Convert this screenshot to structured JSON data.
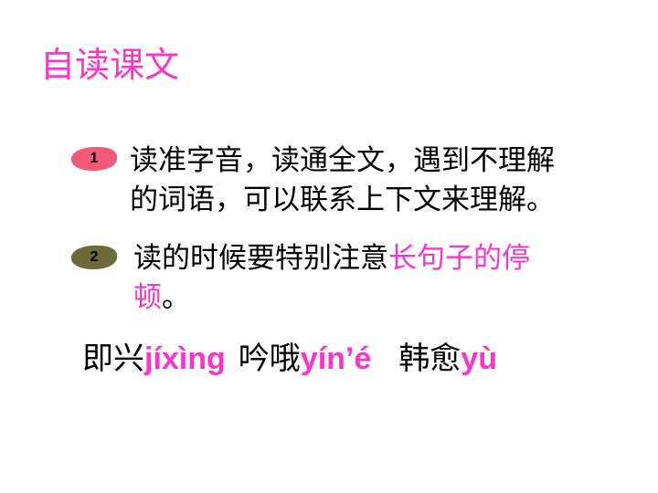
{
  "colors": {
    "accent": "#ff33cc",
    "badge_1": "#f05a78",
    "badge_2": "#6b6a38",
    "text": "#000000"
  },
  "title": "自读课文",
  "items": [
    {
      "number": "1",
      "line1": "读准字音，读通全文，遇到不理解",
      "line2": "的词语，可以联系上下文来理解。"
    },
    {
      "number": "2",
      "line1_plain": "读的时候要特别注意",
      "line1_highlight": "长句子的停",
      "line2_highlight": "顿",
      "line2_plain": "。"
    }
  ],
  "vocab": [
    {
      "word": "即兴",
      "pinyin": "jíxìng"
    },
    {
      "word": "吟哦",
      "pinyin": "yín’é"
    },
    {
      "word": "韩愈",
      "pinyin": "yù"
    }
  ]
}
